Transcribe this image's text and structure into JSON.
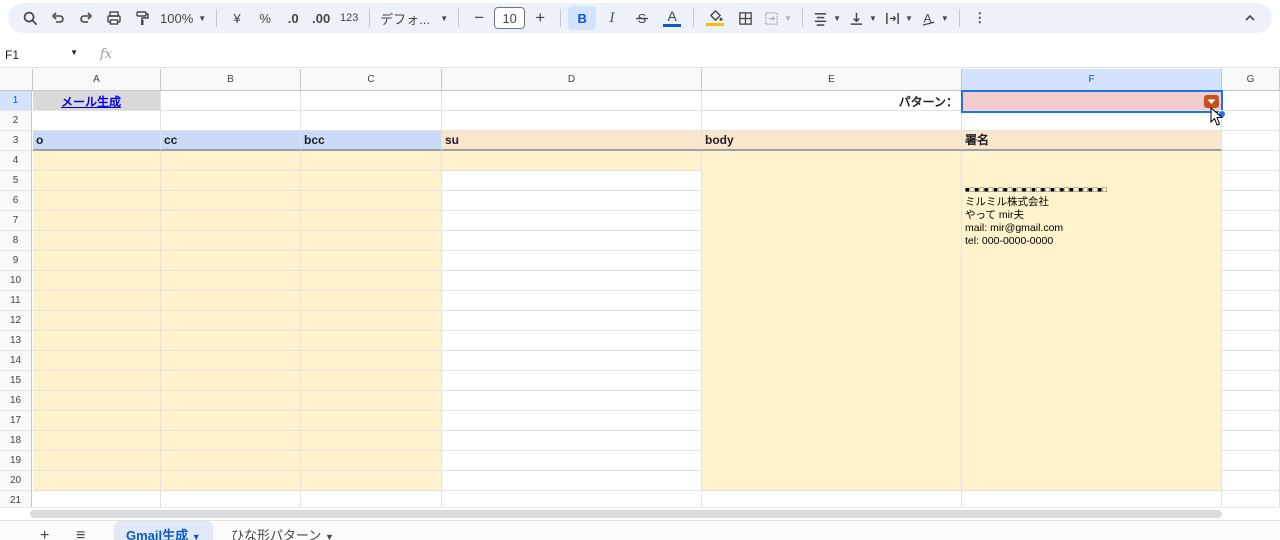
{
  "toolbar": {
    "zoom": "100%",
    "currency": "¥",
    "percent": "%",
    "dec_decrease": ".0",
    "dec_increase": ".00",
    "number_format": "123",
    "font": "デフォ...",
    "font_size": "10",
    "bold": "B",
    "italic": "I",
    "text_color_letter": "A",
    "text_color": "#0b57d0",
    "fill_color": "#fbbc04",
    "more": "⋮",
    "collapse": "^"
  },
  "formula_bar": {
    "cell_ref": "F1",
    "fx": "fx"
  },
  "columns": [
    "A",
    "B",
    "C",
    "D",
    "E",
    "F",
    "G"
  ],
  "selected_column": "F",
  "rows": [
    "1",
    "2",
    "3",
    "4",
    "5",
    "6",
    "7",
    "8",
    "9",
    "10",
    "11",
    "12",
    "13",
    "14",
    "15",
    "16",
    "17",
    "18",
    "19",
    "20",
    "21"
  ],
  "cells": {
    "a1_link": "メール生成",
    "e1_label": "パターン：",
    "a3": "o",
    "b3": "cc",
    "c3": "bcc",
    "d3": "su",
    "e3": "body",
    "f3": "署名",
    "signature_line1": "■□■□■□■□■□■□■□■□■□■□■□■□■□■□■□",
    "signature_line2": "ミルミル株式会社",
    "signature_line3": "やって mir夫",
    "signature_line4": "mail: mir@gmail.com",
    "signature_line5": "tel: 000-0000-0000"
  },
  "colors": {
    "header_blue": "#c9daf8",
    "header_peach": "#fce5cd",
    "fill_yellow": "#fff2cc",
    "dropdown_fill": "#f4cccc",
    "dropdown_arrow": "#c5511f"
  },
  "sheets": [
    {
      "label": "Gmail生成",
      "active": true
    },
    {
      "label": "ひな形パターン",
      "active": false
    }
  ]
}
